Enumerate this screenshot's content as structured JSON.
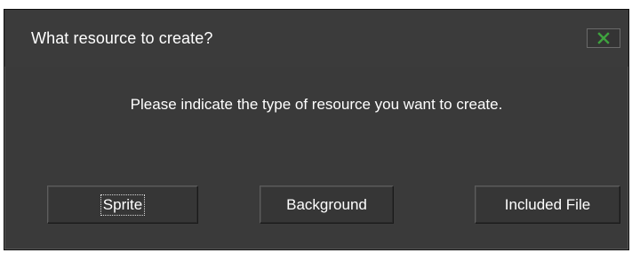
{
  "window": {
    "title": "What resource to create?",
    "close_icon": "close-x-icon",
    "close_icon_color": "#3ea33e"
  },
  "message": "Please indicate the type of resource you want to create.",
  "buttons": {
    "sprite": "Sprite",
    "background": "Background",
    "included_file": "Included File"
  }
}
